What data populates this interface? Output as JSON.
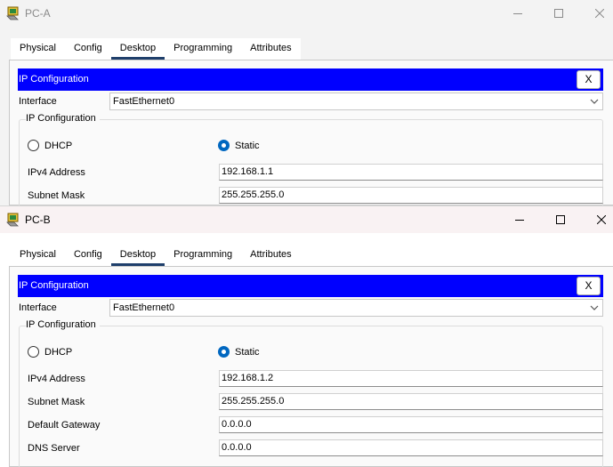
{
  "windows": [
    {
      "title": "PC-A",
      "tabs": [
        "Physical",
        "Config",
        "Desktop",
        "Programming",
        "Attributes"
      ],
      "active_tab": "Desktop",
      "panel_title": "IP Configuration",
      "close_label": "X",
      "interface_label": "Interface",
      "interface_value": "FastEthernet0",
      "group_title": "IP Configuration",
      "dhcp_label": "DHCP",
      "static_label": "Static",
      "mode": "Static",
      "fields": [
        {
          "label": "IPv4 Address",
          "value": "192.168.1.1"
        },
        {
          "label": "Subnet Mask",
          "value": "255.255.255.0"
        }
      ]
    },
    {
      "title": "PC-B",
      "tabs": [
        "Physical",
        "Config",
        "Desktop",
        "Programming",
        "Attributes"
      ],
      "active_tab": "Desktop",
      "panel_title": "IP Configuration",
      "close_label": "X",
      "interface_label": "Interface",
      "interface_value": "FastEthernet0",
      "group_title": "IP Configuration",
      "dhcp_label": "DHCP",
      "static_label": "Static",
      "mode": "Static",
      "fields": [
        {
          "label": "IPv4 Address",
          "value": "192.168.1.2"
        },
        {
          "label": "Subnet Mask",
          "value": "255.255.255.0"
        },
        {
          "label": "Default Gateway",
          "value": "0.0.0.0"
        },
        {
          "label": "DNS Server",
          "value": "0.0.0.0"
        }
      ]
    }
  ],
  "icons": {
    "app": "packet-tracer-pc-icon",
    "minimize": "minimize-icon",
    "maximize": "maximize-icon",
    "close": "close-icon",
    "dropdown": "chevron-down-icon"
  },
  "colors": {
    "accent_bar": "#0000ff",
    "active_tab_underline": "#1f3f6b",
    "radio_selected": "#0067c0"
  }
}
